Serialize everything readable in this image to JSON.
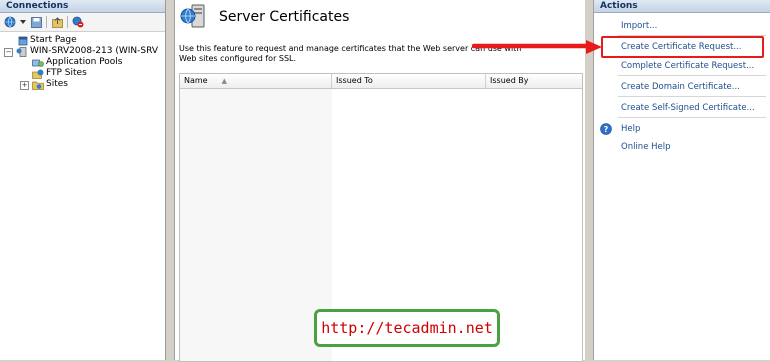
{
  "connections": {
    "header": "Connections",
    "tree": [
      {
        "label": "Start Page"
      },
      {
        "label": "WIN-SRV2008-213 (WIN-SRV"
      },
      {
        "label": "Application Pools"
      },
      {
        "label": "FTP Sites"
      },
      {
        "label": "Sites"
      }
    ],
    "tree_expanders": [
      "−",
      "+"
    ]
  },
  "main": {
    "title": "Server Certificates",
    "description": "Use this feature to request and manage certificates that the Web server can use with Web sites configured for SSL.",
    "columns": [
      "Name",
      "Issued To",
      "Issued By"
    ],
    "sort_indicator": "▲"
  },
  "actions": {
    "header": "Actions",
    "items": [
      "Import...",
      "Create Certificate Request...",
      "Complete Certificate Request...",
      "Create Domain Certificate...",
      "Create Self-Signed Certificate..."
    ],
    "help": "Help",
    "online_help": "Online Help",
    "highlight_color": "#e81b1b"
  },
  "watermark": {
    "text": "http://tecadmin.net",
    "border_color": "#47a23f",
    "text_color": "#d00000"
  }
}
